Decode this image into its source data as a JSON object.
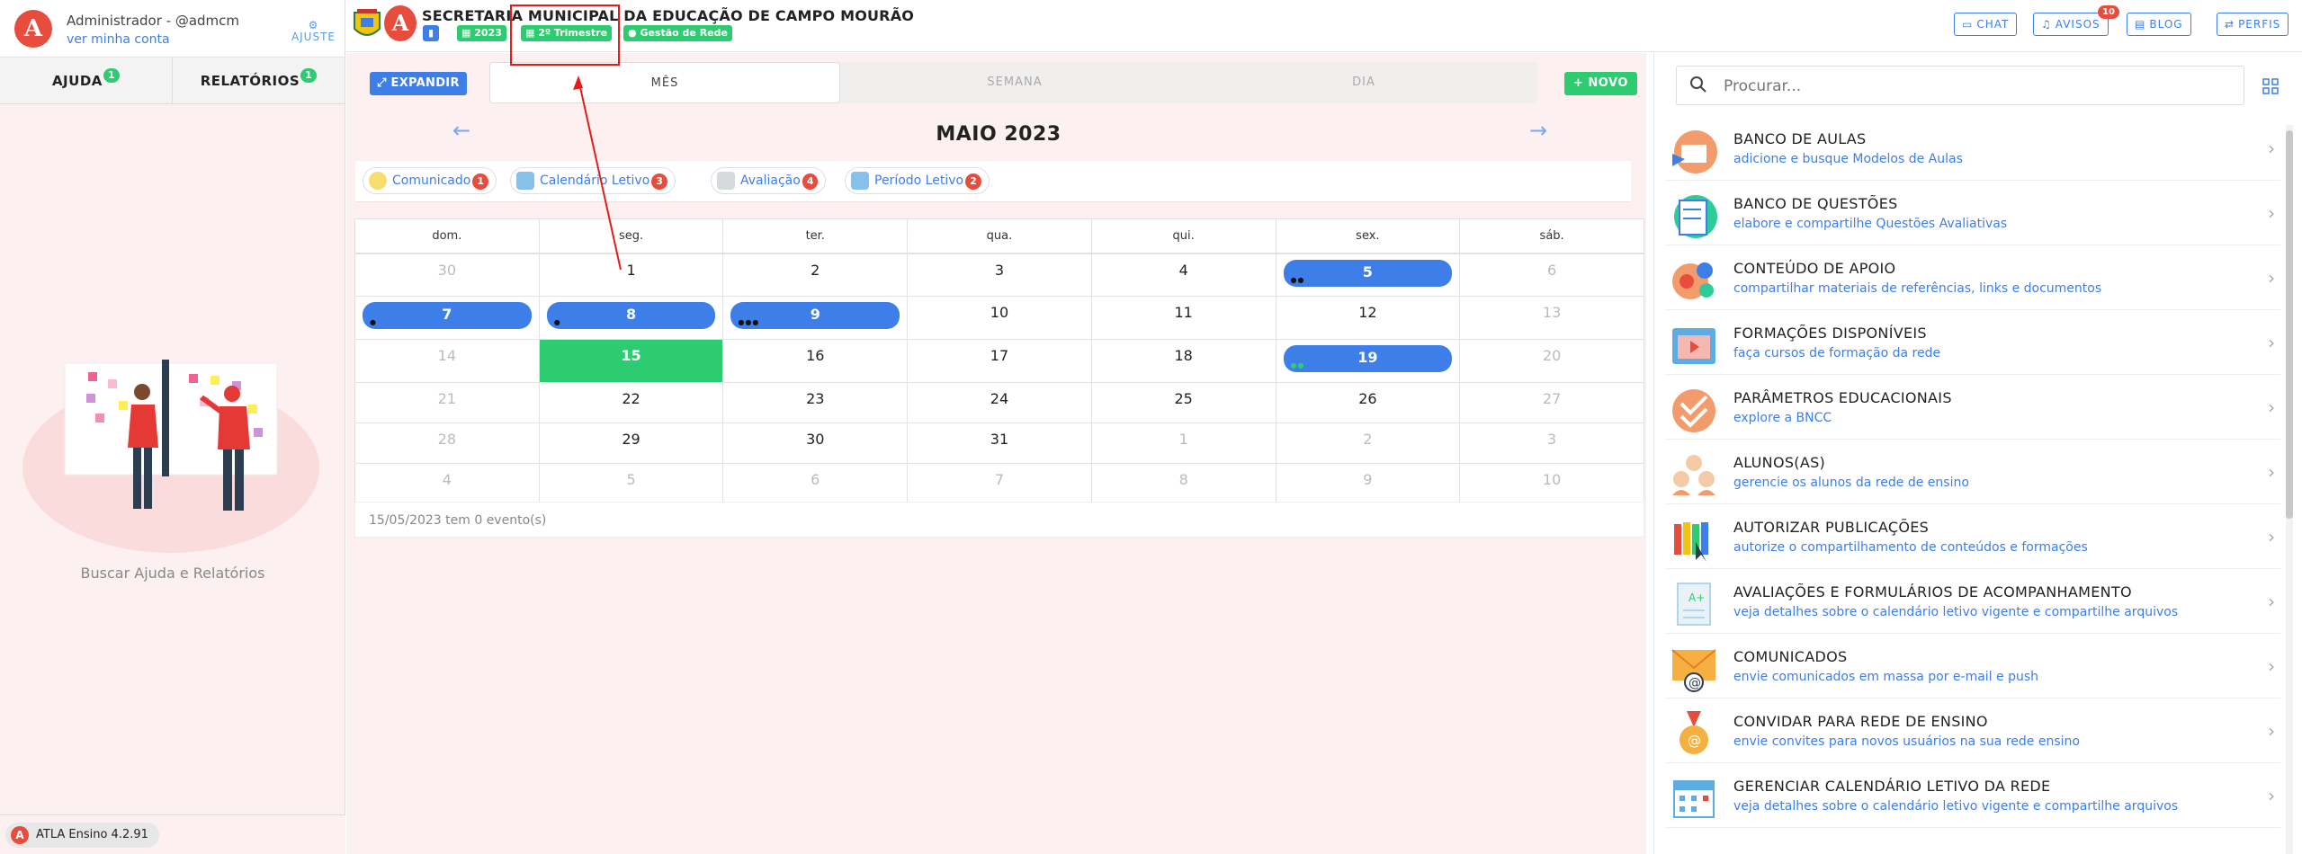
{
  "user": {
    "name": "Administrador - @admcm",
    "account_link": "ver minha conta",
    "settings_label": "AJUSTE"
  },
  "left_tabs": [
    {
      "label": "AJUDA",
      "count": "1"
    },
    {
      "label": "RELATÓRIOS",
      "count": "1"
    }
  ],
  "left_caption": "Buscar Ajuda e Relatórios",
  "version": "ATLA Ensino 4.2.91",
  "header": {
    "org_title": "SECRETARIA MUNICIPAL DA EDUCAÇÃO DE CAMPO MOURÃO",
    "badges": {
      "year": "2023",
      "term": "2º Trimestre",
      "network": "Gestão de Rede"
    },
    "buttons": {
      "chat": "CHAT",
      "avisos": "AVISOS",
      "avisos_count": "10",
      "blog": "BLOG",
      "perfis": "PERFIS"
    }
  },
  "calendar": {
    "expand_label": "EXPANDIR",
    "new_label": "NOVO",
    "views": [
      "MÊS",
      "SEMANA",
      "DIA"
    ],
    "active_view": "MÊS",
    "month_title": "MAIO 2023",
    "filters": [
      {
        "label": "Comunicado",
        "count": "1",
        "color": "#f1c40f"
      },
      {
        "label": "Calendário Letivo",
        "count": "3",
        "color": "#3d7ee8"
      },
      {
        "label": "Avaliação",
        "count": "4",
        "color": "#9aa5b1"
      },
      {
        "label": "Período Letivo",
        "count": "2",
        "color": "#3d7ee8"
      }
    ],
    "weekdays": [
      "dom.",
      "seg.",
      "ter.",
      "qua.",
      "qui.",
      "sex.",
      "sáb."
    ],
    "weeks": [
      [
        "30",
        "1",
        "2",
        "3",
        "4",
        "5",
        "6"
      ],
      [
        "7",
        "8",
        "9",
        "10",
        "11",
        "12",
        "13"
      ],
      [
        "14",
        "15",
        "16",
        "17",
        "18",
        "19",
        "20"
      ],
      [
        "21",
        "22",
        "23",
        "24",
        "25",
        "26",
        "27"
      ],
      [
        "28",
        "29",
        "30",
        "31",
        "1",
        "2",
        "3"
      ],
      [
        "4",
        "5",
        "6",
        "7",
        "8",
        "9",
        "10"
      ]
    ],
    "status": "15/05/2023 tem 0 evento(s)"
  },
  "search": {
    "placeholder": "Procurar..."
  },
  "menu": [
    {
      "title": "BANCO DE AULAS",
      "subtitle": "adicione e busque Modelos de Aulas",
      "icon": "lessons-icon"
    },
    {
      "title": "BANCO DE QUESTÕES",
      "subtitle": "elabore e compartilhe Questões Avaliativas",
      "icon": "questions-icon"
    },
    {
      "title": "CONTEÚDO DE APOIO",
      "subtitle": "compartilhar materiais de referências, links e documentos",
      "icon": "support-content-icon"
    },
    {
      "title": "FORMAÇÕES DISPONÍVEIS",
      "subtitle": "faça cursos de formação da rede",
      "icon": "training-icon"
    },
    {
      "title": "PARÂMETROS EDUCACIONAIS",
      "subtitle": "explore a BNCC",
      "icon": "parameters-icon"
    },
    {
      "title": "ALUNOS(AS)",
      "subtitle": "gerencie os alunos da rede de ensino",
      "icon": "students-icon"
    },
    {
      "title": "AUTORIZAR PUBLICAÇÕES",
      "subtitle": "autorize o compartilhamento de conteúdos e formações",
      "icon": "publications-icon"
    },
    {
      "title": "AVALIAÇÕES E FORMULÁRIOS DE ACOMPANHAMENTO",
      "subtitle": "veja detalhes sobre o calendário letivo vigente e compartilhe arquivos",
      "icon": "evaluations-icon"
    },
    {
      "title": "COMUNICADOS",
      "subtitle": "envie comunicados em massa por e-mail e push",
      "icon": "mail-icon"
    },
    {
      "title": "CONVIDAR PARA REDE DE ENSINO",
      "subtitle": "envie convites para novos usuários na sua rede ensino",
      "icon": "invite-icon"
    },
    {
      "title": "GERENCIAR CALENDÁRIO LETIVO DA REDE",
      "subtitle": "veja detalhes sobre o calendário letivo vigente e compartilhe arquivos",
      "icon": "calendar-icon"
    }
  ]
}
